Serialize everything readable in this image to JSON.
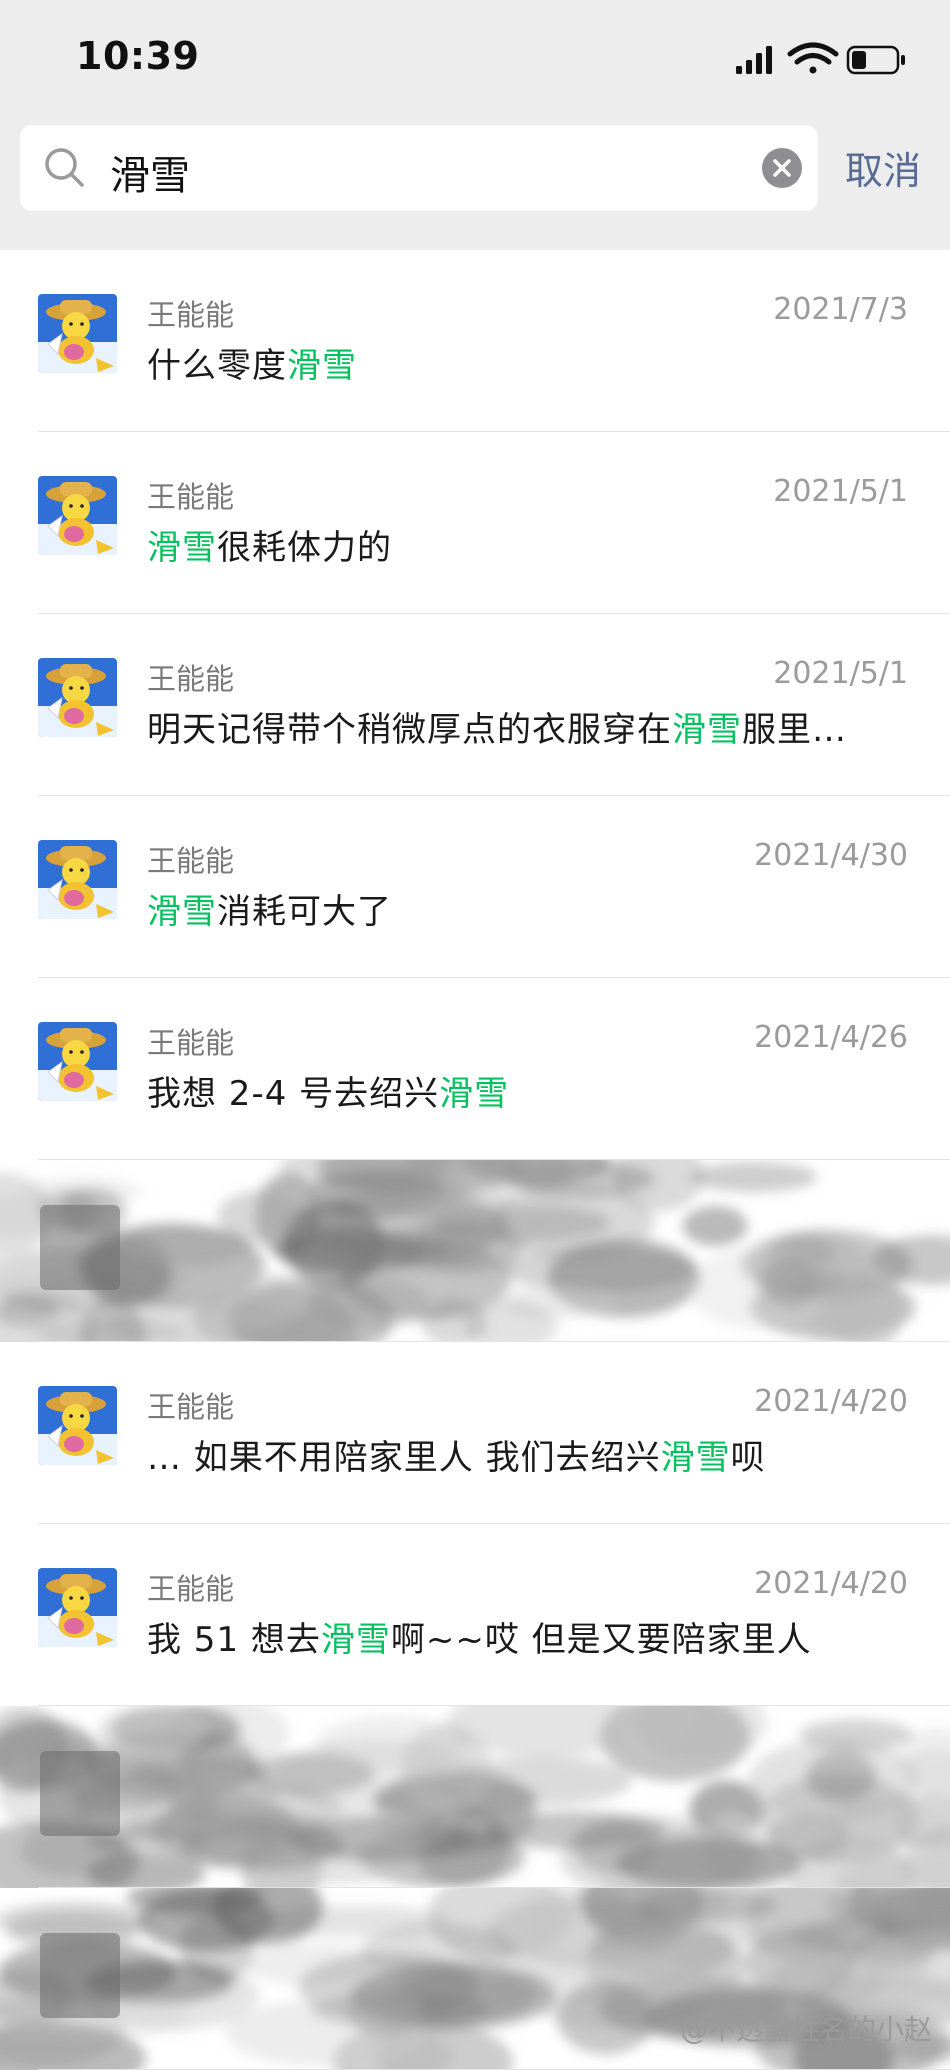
{
  "status_bar": {
    "time": "10:39"
  },
  "search": {
    "query": "滑雪",
    "cancel_label": "取消"
  },
  "results": [
    {
      "sender": "王能能",
      "date": "2021/7/3",
      "before": "什么零度",
      "keyword": "滑雪",
      "after": ""
    },
    {
      "sender": "王能能",
      "date": "2021/5/1",
      "before": "",
      "keyword": "滑雪",
      "after": "很耗体力的"
    },
    {
      "sender": "王能能",
      "date": "2021/5/1",
      "before": "明天记得带个稍微厚点的衣服穿在",
      "keyword": "滑雪",
      "after": "服里…"
    },
    {
      "sender": "王能能",
      "date": "2021/4/30",
      "before": "",
      "keyword": "滑雪",
      "after": "消耗可大了"
    },
    {
      "sender": "王能能",
      "date": "2021/4/26",
      "before": "我想 2-4 号去绍兴",
      "keyword": "滑雪",
      "after": ""
    },
    {
      "sender": "王能能",
      "date": "2021/4/20",
      "before": "…  如果不用陪家里人 我们去绍兴",
      "keyword": "滑雪",
      "after": "呗"
    },
    {
      "sender": "王能能",
      "date": "2021/4/20",
      "before": "我 51 想去",
      "keyword": "滑雪",
      "after": "啊~~哎 但是又要陪家里人"
    }
  ],
  "watermark": "@不透露姓名的小赵",
  "colors": {
    "highlight": "#07c160",
    "cancel": "#576b95",
    "header_bg": "#ededed"
  }
}
